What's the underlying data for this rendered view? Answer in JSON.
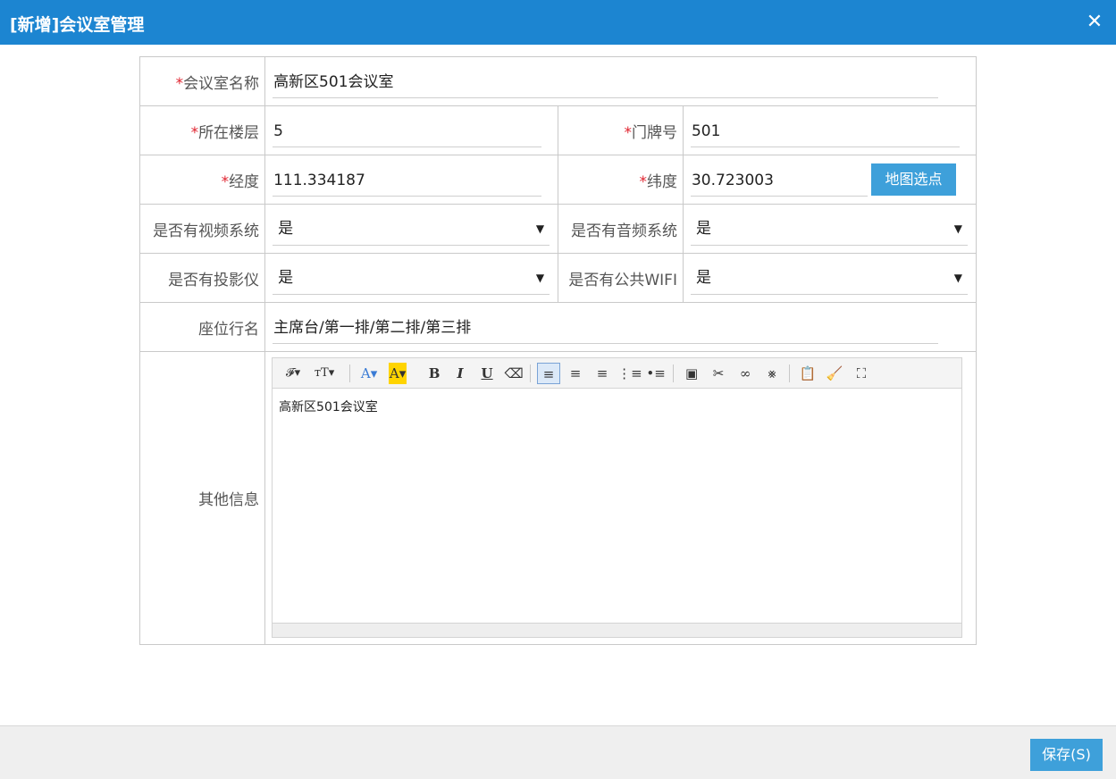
{
  "dialog": {
    "title": "[新增]会议室管理",
    "close_glyph": "✕"
  },
  "form": {
    "required_mark": "*",
    "room_name": {
      "label": "会议室名称",
      "value": "高新区501会议室",
      "required": true
    },
    "floor": {
      "label": "所在楼层",
      "value": "5",
      "required": true
    },
    "door_no": {
      "label": "门牌号",
      "value": "501",
      "required": true
    },
    "longitude": {
      "label": "经度",
      "value": "111.334187",
      "required": true
    },
    "latitude": {
      "label": "纬度",
      "value": "30.723003",
      "required": true
    },
    "map_pick_button": "地图选点",
    "video_system": {
      "label": "是否有视频系统",
      "value": "是"
    },
    "audio_system": {
      "label": "是否有音频系统",
      "value": "是"
    },
    "projector": {
      "label": "是否有投影仪",
      "value": "是"
    },
    "public_wifi": {
      "label": "是否有公共WIFI",
      "value": "是"
    },
    "seat_rows": {
      "label": "座位行名",
      "value": "主席台/第一排/第二排/第三排"
    },
    "other_info": {
      "label": "其他信息",
      "content": "高新区501会议室"
    },
    "dropdown_arrow": "▼"
  },
  "editor_toolbar": [
    {
      "name": "font-family-icon",
      "glyph": "𝓕▾"
    },
    {
      "name": "font-size-icon",
      "glyph": "ᴛT▾"
    },
    {
      "name": "font-color-icon",
      "glyph": "A▾"
    },
    {
      "name": "highlight-color-icon",
      "glyph": "A▾"
    },
    {
      "name": "bold-icon",
      "glyph": "B"
    },
    {
      "name": "italic-icon",
      "glyph": "I"
    },
    {
      "name": "underline-icon",
      "glyph": "U"
    },
    {
      "name": "eraser-icon",
      "glyph": "⌫"
    },
    {
      "name": "align-left-icon",
      "glyph": "≡"
    },
    {
      "name": "align-center-icon",
      "glyph": "≡"
    },
    {
      "name": "align-right-icon",
      "glyph": "≡"
    },
    {
      "name": "ordered-list-icon",
      "glyph": "⋮≡"
    },
    {
      "name": "unordered-list-icon",
      "glyph": "•≡"
    },
    {
      "name": "insert-image-icon",
      "glyph": "▣"
    },
    {
      "name": "cut-icon",
      "glyph": "✂"
    },
    {
      "name": "link-icon",
      "glyph": "∞"
    },
    {
      "name": "unlink-icon",
      "glyph": "⨳"
    },
    {
      "name": "paste-icon",
      "glyph": "📋"
    },
    {
      "name": "clear-format-icon",
      "glyph": "🧹"
    },
    {
      "name": "fullscreen-icon",
      "glyph": "⛶"
    }
  ],
  "colors": {
    "header": "#1c85d1",
    "button": "#3ea0da",
    "required": "#e0232f"
  },
  "footer": {
    "save_label": "保存(S)"
  }
}
